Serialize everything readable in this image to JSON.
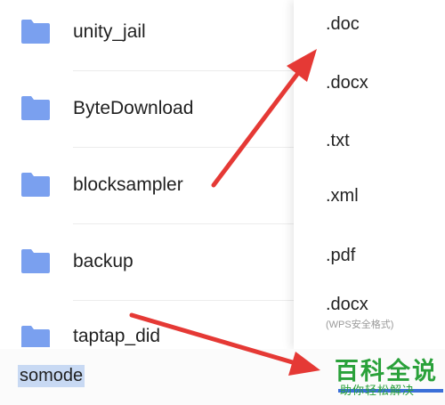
{
  "files": [
    {
      "name": "unity_jail"
    },
    {
      "name": "ByteDownload"
    },
    {
      "name": "blocksampler"
    },
    {
      "name": "backup"
    },
    {
      "name": "taptap_did"
    }
  ],
  "extension_menu": {
    "items": [
      ".doc",
      ".docx",
      ".txt",
      ".xml",
      ".pdf",
      ".docx"
    ],
    "last_item_note": "(WPS安全格式)"
  },
  "filename_input": {
    "value": "somode"
  },
  "watermark": {
    "title": "百科全说",
    "subtitle": "助你轻松解决"
  },
  "colors": {
    "folder": "#7aa0ef",
    "arrow": "#e53935",
    "accent": "#3a6fd8",
    "watermark": "#2aa13a"
  }
}
